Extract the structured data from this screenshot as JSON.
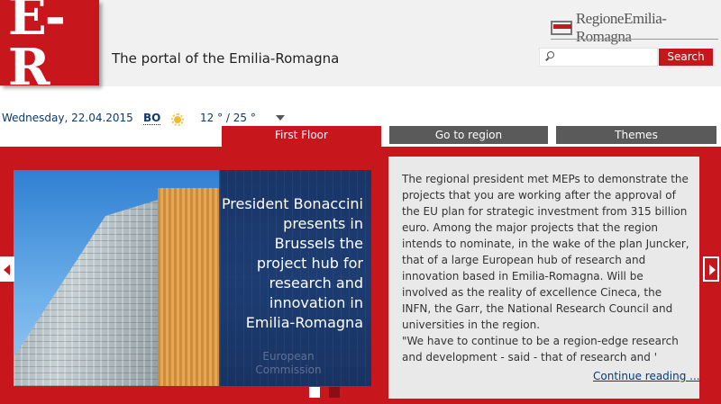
{
  "header": {
    "logo_text": "E-R",
    "portal_title": "The portal of the Emilia-Romagna",
    "region_brand": "RegioneEmilia-Romagna",
    "search": {
      "placeholder": "",
      "value": "",
      "button_label": "Search"
    }
  },
  "info_bar": {
    "date": "Wednesday, 22.04.2015",
    "city": "BO",
    "weather_icon": "sun-icon",
    "temperature": "12 ° / 25 °"
  },
  "tabs": [
    {
      "label": "First Floor",
      "active": true
    },
    {
      "label": "Go to region",
      "active": false
    },
    {
      "label": "Themes",
      "active": false
    }
  ],
  "slide": {
    "caption": "President Bonaccini presents in Brussels the project hub for research and innovation in Emilia-Romagna",
    "image_text": "European Commission",
    "dots": [
      {
        "active": true
      },
      {
        "active": false
      }
    ]
  },
  "article": {
    "text": "The regional president met MEPs to demonstrate the projects that you are working after the approval of the EU plan for strategic investment from 315 billion euro. Among the major projects that the region intends to nominate, in the wake of the plan Juncker, that of a large European hub of research and innovation based in Emilia-Romagna. Will be involved as the reality of excellence Cineca, the INFN, the Garr, the National Research Council and universities in the region.\n\"We have to continue to be a region-edge research and development - said - that of research and '",
    "continue_label": "Continue reading ..."
  },
  "colors": {
    "brand_red": "#c8161d",
    "tab_gray": "#5a5a5a",
    "link_blue": "#0b3a6e"
  }
}
